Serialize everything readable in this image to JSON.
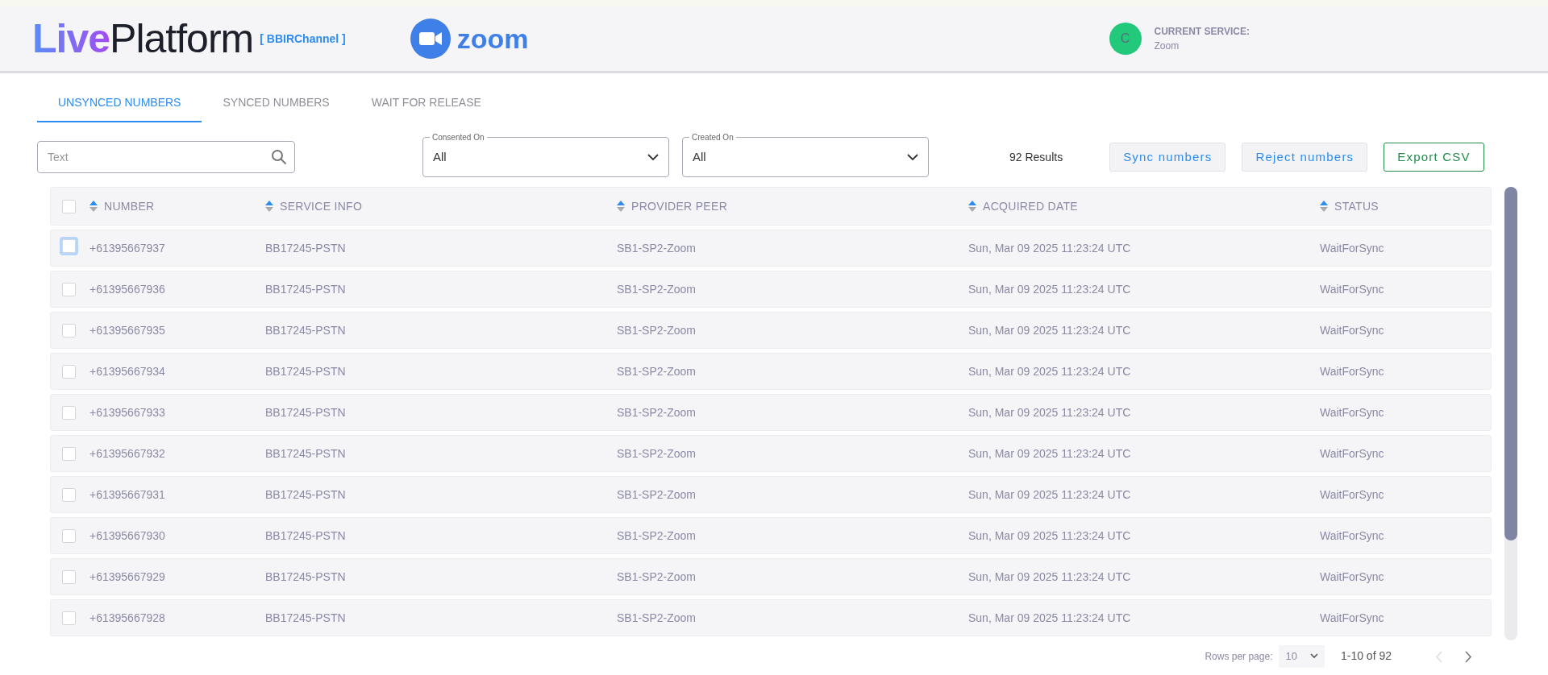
{
  "header": {
    "logo": {
      "part_1": "Live",
      "part_2": "Platform"
    },
    "channel": "[ BBIRChannel ]",
    "service_logo_text": "zoom",
    "avatar_letter": "C",
    "current_service_label": "CURRENT SERVICE:",
    "current_service": "Zoom"
  },
  "tabs": [
    {
      "label": "UNSYNCED NUMBERS",
      "selected": true
    },
    {
      "label": "SYNCED NUMBERS",
      "selected": false
    },
    {
      "label": "WAIT FOR RELEASE",
      "selected": false
    }
  ],
  "search": {
    "placeholder": "Text"
  },
  "filters": [
    {
      "label": "Consented On",
      "value": "All"
    },
    {
      "label": "Created On",
      "value": "All"
    }
  ],
  "results": "92 Results",
  "buttons": [
    {
      "label": "Sync numbers",
      "kind": "primary"
    },
    {
      "label": "Reject numbers",
      "kind": "primary"
    },
    {
      "label": "Export CSV",
      "kind": "success"
    }
  ],
  "table": {
    "columns": [
      "NUMBER",
      "SERVICE INFO",
      "PROVIDER PEER",
      "ACQUIRED DATE",
      "STATUS"
    ],
    "header_checked": false,
    "rows": [
      {
        "cells": [
          "+61395667937",
          "BB17245-PSTN",
          "SB1-SP2-Zoom",
          "Sun, Mar 09 2025 11:23:24 UTC",
          "WaitForSync"
        ],
        "checked": false,
        "focused": true
      },
      {
        "cells": [
          "+61395667936",
          "BB17245-PSTN",
          "SB1-SP2-Zoom",
          "Sun, Mar 09 2025 11:23:24 UTC",
          "WaitForSync"
        ],
        "checked": false,
        "focused": false
      },
      {
        "cells": [
          "+61395667935",
          "BB17245-PSTN",
          "SB1-SP2-Zoom",
          "Sun, Mar 09 2025 11:23:24 UTC",
          "WaitForSync"
        ],
        "checked": false,
        "focused": false
      },
      {
        "cells": [
          "+61395667934",
          "BB17245-PSTN",
          "SB1-SP2-Zoom",
          "Sun, Mar 09 2025 11:23:24 UTC",
          "WaitForSync"
        ],
        "checked": false,
        "focused": false
      },
      {
        "cells": [
          "+61395667933",
          "BB17245-PSTN",
          "SB1-SP2-Zoom",
          "Sun, Mar 09 2025 11:23:24 UTC",
          "WaitForSync"
        ],
        "checked": false,
        "focused": false
      },
      {
        "cells": [
          "+61395667932",
          "BB17245-PSTN",
          "SB1-SP2-Zoom",
          "Sun, Mar 09 2025 11:23:24 UTC",
          "WaitForSync"
        ],
        "checked": false,
        "focused": false
      },
      {
        "cells": [
          "+61395667931",
          "BB17245-PSTN",
          "SB1-SP2-Zoom",
          "Sun, Mar 09 2025 11:23:24 UTC",
          "WaitForSync"
        ],
        "checked": false,
        "focused": false
      },
      {
        "cells": [
          "+61395667930",
          "BB17245-PSTN",
          "SB1-SP2-Zoom",
          "Sun, Mar 09 2025 11:23:24 UTC",
          "WaitForSync"
        ],
        "checked": false,
        "focused": false
      },
      {
        "cells": [
          "+61395667929",
          "BB17245-PSTN",
          "SB1-SP2-Zoom",
          "Sun, Mar 09 2025 11:23:24 UTC",
          "WaitForSync"
        ],
        "checked": false,
        "focused": false
      },
      {
        "cells": [
          "+61395667928",
          "BB17245-PSTN",
          "SB1-SP2-Zoom",
          "Sun, Mar 09 2025 11:23:24 UTC",
          "WaitForSync"
        ],
        "checked": false,
        "focused": false
      }
    ]
  },
  "pagination": {
    "rows_label": "Rows per page:",
    "rows_value": "10",
    "range": "1-10 of 92",
    "prev_disabled": true,
    "next_disabled": false
  }
}
